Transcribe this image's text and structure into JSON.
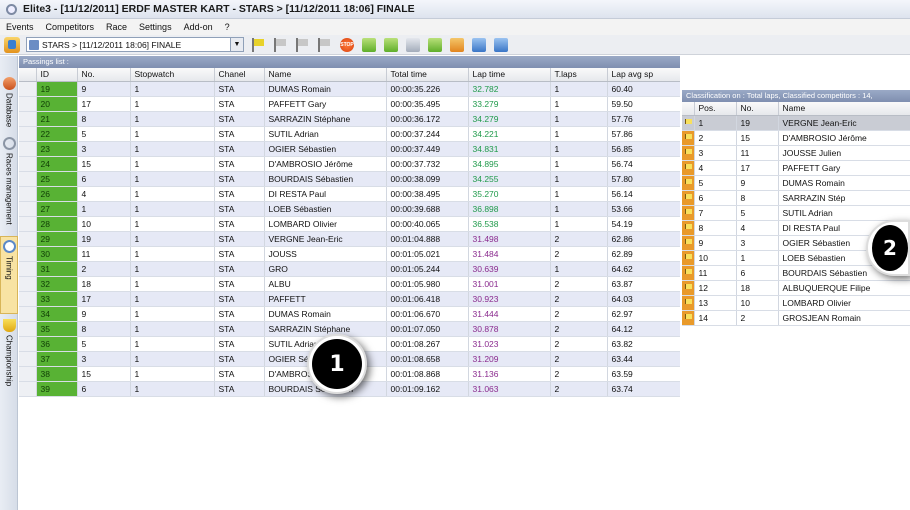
{
  "window": {
    "title": "Elite3 - [11/12/2011] ERDF MASTER KART - STARS > [11/12/2011 18:06] FINALE"
  },
  "menu": [
    "Events",
    "Competitors",
    "Race",
    "Settings",
    "Add-on",
    "?"
  ],
  "toolbar": {
    "race_select": "STARS > [11/12/2011 18:06] FINALE",
    "stop_label": "STOP"
  },
  "sidebar": [
    "Database",
    "Races management",
    "Timing",
    "Championship"
  ],
  "passings": {
    "header": "Passings list :",
    "columns": [
      "ID",
      "No.",
      "Stopwatch",
      "Chanel",
      "Name",
      "Total time",
      "Lap time",
      "T.laps",
      "Lap avg sp"
    ],
    "rows": [
      [
        "19",
        "9",
        "1",
        "STA",
        "DUMAS Romain",
        "00:00:35.226",
        "32.782",
        "1",
        "60.40"
      ],
      [
        "20",
        "17",
        "1",
        "STA",
        "PAFFETT Gary",
        "00:00:35.495",
        "33.279",
        "1",
        "59.50"
      ],
      [
        "21",
        "8",
        "1",
        "STA",
        "SARRAZIN Stéphane",
        "00:00:36.172",
        "34.279",
        "1",
        "57.76"
      ],
      [
        "22",
        "5",
        "1",
        "STA",
        "SUTIL Adrian",
        "00:00:37.244",
        "34.221",
        "1",
        "57.86"
      ],
      [
        "23",
        "3",
        "1",
        "STA",
        "OGIER Sébastien",
        "00:00:37.449",
        "34.831",
        "1",
        "56.85"
      ],
      [
        "24",
        "15",
        "1",
        "STA",
        "D'AMBROSIO Jérôme",
        "00:00:37.732",
        "34.895",
        "1",
        "56.74"
      ],
      [
        "25",
        "6",
        "1",
        "STA",
        "BOURDAIS Sébastien",
        "00:00:38.099",
        "34.255",
        "1",
        "57.80"
      ],
      [
        "26",
        "4",
        "1",
        "STA",
        "DI RESTA Paul",
        "00:00:38.495",
        "35.270",
        "1",
        "56.14"
      ],
      [
        "27",
        "1",
        "1",
        "STA",
        "LOEB Sébastien",
        "00:00:39.688",
        "36.898",
        "1",
        "53.66"
      ],
      [
        "28",
        "10",
        "1",
        "STA",
        "LOMBARD Olivier",
        "00:00:40.065",
        "36.538",
        "1",
        "54.19"
      ],
      [
        "29",
        "19",
        "1",
        "STA",
        "VERGNE Jean-Eric",
        "00:01:04.888",
        "31.498",
        "2",
        "62.86"
      ],
      [
        "30",
        "11",
        "1",
        "STA",
        "JOUSS",
        "00:01:05.021",
        "31.484",
        "2",
        "62.89"
      ],
      [
        "31",
        "2",
        "1",
        "STA",
        "GRO",
        "00:01:05.244",
        "30.639",
        "1",
        "64.62"
      ],
      [
        "32",
        "18",
        "1",
        "STA",
        "ALBU",
        "00:01:05.980",
        "31.001",
        "2",
        "63.87"
      ],
      [
        "33",
        "17",
        "1",
        "STA",
        "PAFFETT",
        "00:01:06.418",
        "30.923",
        "2",
        "64.03"
      ],
      [
        "34",
        "9",
        "1",
        "STA",
        "DUMAS Romain",
        "00:01:06.670",
        "31.444",
        "2",
        "62.97"
      ],
      [
        "35",
        "8",
        "1",
        "STA",
        "SARRAZIN Stéphane",
        "00:01:07.050",
        "30.878",
        "2",
        "64.12"
      ],
      [
        "36",
        "5",
        "1",
        "STA",
        "SUTIL Adrian",
        "00:01:08.267",
        "31.023",
        "2",
        "63.82"
      ],
      [
        "37",
        "3",
        "1",
        "STA",
        "OGIER Sébastien",
        "00:01:08.658",
        "31.209",
        "2",
        "63.44"
      ],
      [
        "38",
        "15",
        "1",
        "STA",
        "D'AMBROSIO Jérôme",
        "00:01:08.868",
        "31.136",
        "2",
        "63.59"
      ],
      [
        "39",
        "6",
        "1",
        "STA",
        "BOURDAIS Sébastien",
        "00:01:09.162",
        "31.063",
        "2",
        "63.74"
      ]
    ]
  },
  "classification": {
    "header": "Classification on : Total laps, Classified competitors : 14,",
    "columns": [
      "Pos.",
      "No.",
      "Name"
    ],
    "rows": [
      [
        "1",
        "19",
        "VERGNE Jean-Eric"
      ],
      [
        "2",
        "15",
        "D'AMBROSIO Jérôme"
      ],
      [
        "3",
        "11",
        "JOUSSE Julien"
      ],
      [
        "4",
        "17",
        "PAFFETT Gary"
      ],
      [
        "5",
        "9",
        "DUMAS Romain"
      ],
      [
        "6",
        "8",
        "SARRAZIN Stép"
      ],
      [
        "7",
        "5",
        "SUTIL Adrian"
      ],
      [
        "8",
        "4",
        "DI RESTA Paul"
      ],
      [
        "9",
        "3",
        "OGIER Sébastien"
      ],
      [
        "10",
        "1",
        "LOEB Sébastien"
      ],
      [
        "11",
        "6",
        "BOURDAIS Sébastien"
      ],
      [
        "12",
        "18",
        "ALBUQUERQUE Filipe"
      ],
      [
        "13",
        "10",
        "LOMBARD Olivier"
      ],
      [
        "14",
        "2",
        "GROSJEAN Romain"
      ]
    ]
  },
  "callouts": [
    "1",
    "2"
  ]
}
